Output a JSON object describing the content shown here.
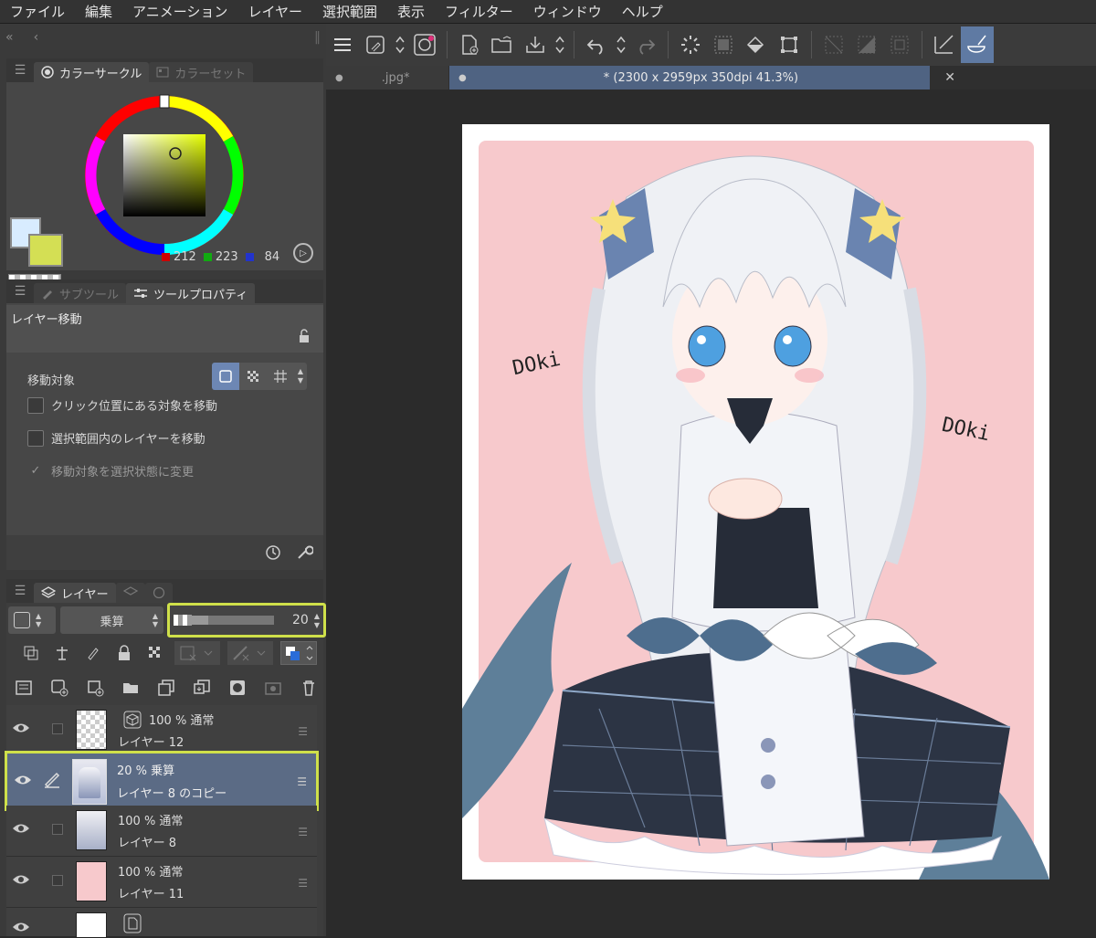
{
  "menu": [
    "ファイル",
    "編集",
    "アニメーション",
    "レイヤー",
    "選択範囲",
    "表示",
    "フィルター",
    "ウィンドウ",
    "ヘルプ"
  ],
  "color_panel": {
    "tab_active": "カラーサークル",
    "tab_inactive": "カラーセット",
    "r": "212",
    "g": "223",
    "b": "84",
    "main_color": "#d4df54",
    "sub_color": "#d8ecff"
  },
  "tool_panel": {
    "tab_inactive": "サブツール",
    "tab_active": "ツールプロパティ",
    "tool_name": "レイヤー移動",
    "move_target_label": "移動対象",
    "option1": "クリック位置にある対象を移動",
    "option2": "選択範囲内のレイヤーを移動",
    "option3": "移動対象を選択状態に変更",
    "option3_checked": true
  },
  "layer_panel": {
    "tab_active": "レイヤー",
    "blend_mode": "乗算",
    "opacity": "20",
    "opacity_fraction": 0.2,
    "layers": [
      {
        "line1": "100 % 通常",
        "line2": "レイヤー 12"
      },
      {
        "line1": "20 % 乗算",
        "line2": "レイヤー 8 のコピー"
      },
      {
        "line1": "100 % 通常",
        "line2": "レイヤー 8"
      },
      {
        "line1": "100 % 通常",
        "line2": "レイヤー 11"
      }
    ]
  },
  "doc_tabs": [
    {
      "label": ".jpg*"
    },
    {
      "label": "* (2300 x 2959px 350dpi 41.3%)"
    }
  ],
  "artwork": {
    "text1": "DOki",
    "text2": "DOki",
    "bg_color": "#f7c9cc"
  },
  "colors": {
    "highlight": "#cfe04a",
    "selected_row": "#5b6b85",
    "accent_button": "#5f7aa3"
  }
}
